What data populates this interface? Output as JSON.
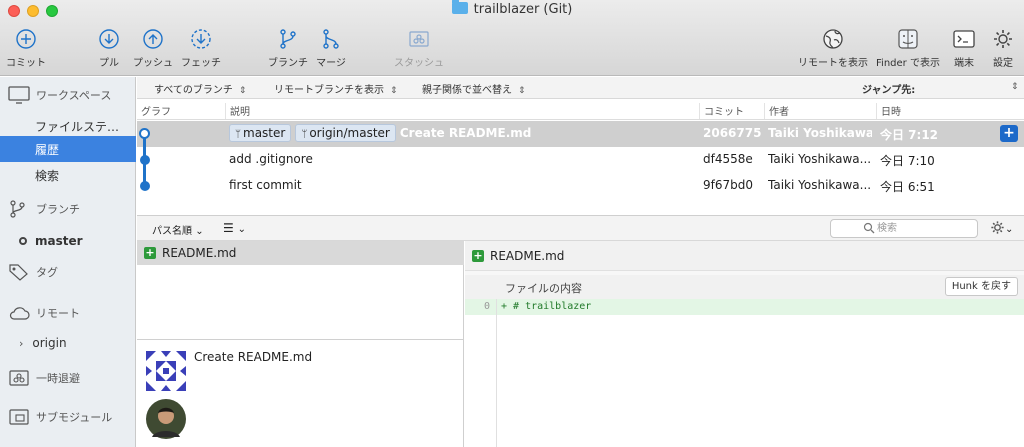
{
  "window": {
    "title": "trailblazer (Git)"
  },
  "toolbar": {
    "commit": "コミット",
    "pull": "プル",
    "push": "プッシュ",
    "fetch": "フェッチ",
    "branch": "ブランチ",
    "merge": "マージ",
    "stash": "スタッシュ",
    "remote": "リモートを表示",
    "finder": "Finder で表示",
    "terminal": "端末",
    "settings": "設定"
  },
  "sidebar": {
    "workspace": "ワークスペース",
    "file_status": "ファイルステ…",
    "history": "履歴",
    "search": "検索",
    "branches": "ブランチ",
    "master": "master",
    "tags": "タグ",
    "remotes": "リモート",
    "origin": "origin",
    "stashes": "一時退避",
    "submodules": "サブモジュール"
  },
  "filter": {
    "branches": "すべてのブランチ",
    "remote": "リモートブランチを表示",
    "order": "親子関係で並べ替え",
    "jump": "ジャンプ先:"
  },
  "columns": {
    "graph": "グラフ",
    "description": "説明",
    "commit": "コミット",
    "author": "作者",
    "date": "日時"
  },
  "commits": [
    {
      "tags": [
        "master",
        "origin/master"
      ],
      "message": "Create README.md",
      "hash": "2066775",
      "author": "Taiki Yoshikawa...",
      "date": "今日 7:12"
    },
    {
      "tags": [],
      "message": "add .gitignore",
      "hash": "df4558e",
      "author": "Taiki Yoshikawa...",
      "date": "今日 7:10"
    },
    {
      "tags": [],
      "message": "first commit",
      "hash": "9f67bd0",
      "author": "Taiki Yoshikawa...",
      "date": "今日 6:51"
    }
  ],
  "lower": {
    "sort": "パス名順",
    "search_placeholder": "検索"
  },
  "files": [
    {
      "name": "README.md"
    }
  ],
  "detail": {
    "message": "Create README.md"
  },
  "diff": {
    "file": "README.md",
    "hunk_title": "ファイルの内容",
    "hunk_button": "Hunk を戻す",
    "line_number": "0",
    "line_text": "+ # trailblazer"
  },
  "colors": {
    "accent": "#3b82e0",
    "graph": "#1f73c9",
    "added": "#2e9a3b"
  }
}
